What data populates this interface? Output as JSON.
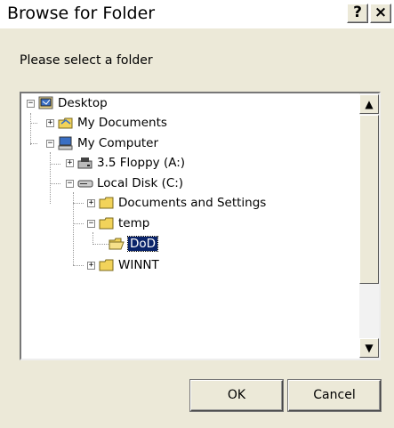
{
  "window": {
    "title": "Browse for Folder",
    "help_label": "?",
    "close_label": "×"
  },
  "prompt": "Please select a folder",
  "tree": {
    "items": [
      {
        "label": "Desktop",
        "toggle": "−",
        "icon": "desktop-icon"
      },
      {
        "label": "My Documents",
        "toggle": "+",
        "icon": "my-documents-folder-icon"
      },
      {
        "label": "My Computer",
        "toggle": "−",
        "icon": "my-computer-icon"
      },
      {
        "label": "3.5 Floppy (A:)",
        "toggle": "+",
        "icon": "floppy-drive-icon"
      },
      {
        "label": "Local Disk (C:)",
        "toggle": "−",
        "icon": "hard-disk-icon"
      },
      {
        "label": "Documents and Settings",
        "toggle": "+",
        "icon": "folder-icon"
      },
      {
        "label": "temp",
        "toggle": "−",
        "icon": "folder-icon"
      },
      {
        "label": "DoD",
        "toggle": "",
        "icon": "folder-open-icon",
        "selected": true
      },
      {
        "label": "WINNT",
        "toggle": "+",
        "icon": "folder-icon"
      }
    ]
  },
  "scrollbar": {
    "up": "▲",
    "down": "▼"
  },
  "buttons": {
    "ok": "OK",
    "cancel": "Cancel"
  }
}
